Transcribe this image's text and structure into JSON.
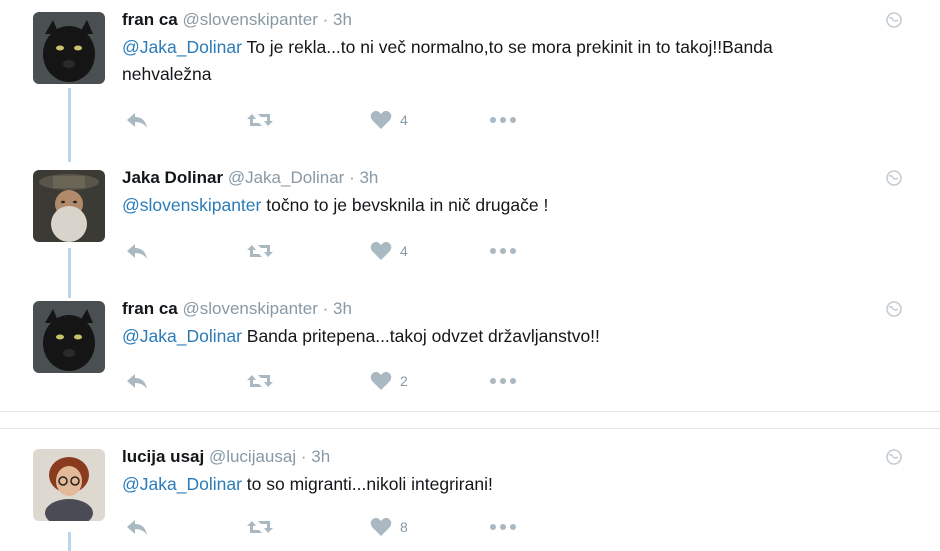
{
  "tweets": [
    {
      "name": "fran ca",
      "handle": "@slovenskipanter",
      "dot": "·",
      "time": "3h",
      "mention": "@Jaka_Dolinar",
      "text": " To je rekla...to ni več normalno,to se mora prekinit in to takoj!!Banda nehvaležna",
      "likes": "4"
    },
    {
      "name": "Jaka Dolinar",
      "handle": "@Jaka_Dolinar",
      "dot": "·",
      "time": "3h",
      "mention": "@slovenskipanter",
      "text": " točno to je bevsknila in nič drugače !",
      "likes": "4"
    },
    {
      "name": "fran ca",
      "handle": "@slovenskipanter",
      "dot": "·",
      "time": "3h",
      "mention": "@Jaka_Dolinar",
      "text": " Banda pritepena...takoj odvzet državljanstvo!!",
      "likes": "2"
    },
    {
      "name": "lucija usaj",
      "handle": "@lucijausaj",
      "dot": "·",
      "time": "3h",
      "mention": "@Jaka_Dolinar",
      "text": " to so migranti...nikoli integrirani!",
      "likes": "8"
    }
  ],
  "icons": {
    "reply": "reply-icon",
    "retweet": "retweet-icon",
    "like": "heart-icon",
    "more": "more-icon",
    "globe": "globe-icon"
  },
  "colors": {
    "mention": "#2b7bb9",
    "muted": "#8899a6",
    "thread_line": "#b8d7ee",
    "icon": "#aab8c2"
  }
}
